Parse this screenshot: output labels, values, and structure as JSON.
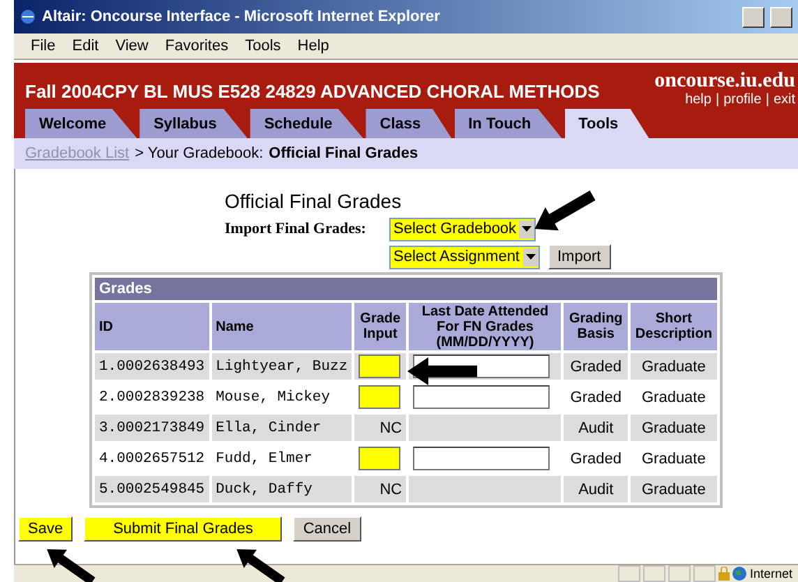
{
  "window": {
    "title": "Altair: Oncourse Interface - Microsoft Internet Explorer"
  },
  "menu": [
    "File",
    "Edit",
    "View",
    "Favorites",
    "Tools",
    "Help"
  ],
  "header": {
    "course": "Fall 2004CPY BL MUS E528 24829 ADVANCED CHORAL METHODS",
    "site": "oncourse.iu.edu",
    "links": [
      "help",
      "profile",
      "exit"
    ],
    "separator": "|"
  },
  "tabs": [
    {
      "label": "Welcome",
      "selected": false
    },
    {
      "label": "Syllabus",
      "selected": false
    },
    {
      "label": "Schedule",
      "selected": false
    },
    {
      "label": "Class",
      "selected": false
    },
    {
      "label": "In Touch",
      "selected": false
    },
    {
      "label": "Tools",
      "selected": true
    }
  ],
  "breadcrumb": {
    "link": "Gradebook List",
    "text": "> Your Gradebook:",
    "current": "Official Final Grades"
  },
  "heading": "Official Final Grades",
  "import": {
    "label": "Import Final Grades:",
    "gradebook": "Select Gradebook",
    "assignment": "Select Assignment",
    "button": "Import"
  },
  "table": {
    "title": "Grades",
    "columns": [
      "ID",
      "Name",
      "Grade Input",
      "Last Date Attended For FN Grades (MM/DD/YYYY)",
      "Grading Basis",
      "Short Description"
    ],
    "rows": [
      {
        "id": "1.0002638493",
        "name": "Lightyear, Buzz",
        "grade": {
          "kind": "input"
        },
        "basis": "Graded",
        "description": "Graduate"
      },
      {
        "id": "2.0002839238",
        "name": "Mouse, Mickey",
        "grade": {
          "kind": "input"
        },
        "basis": "Graded",
        "description": "Graduate"
      },
      {
        "id": "3.0002173849",
        "name": "Ella, Cinder",
        "grade": {
          "kind": "text",
          "text": "NC"
        },
        "basis": "Audit",
        "description": "Graduate"
      },
      {
        "id": "4.0002657512",
        "name": "Fudd, Elmer",
        "grade": {
          "kind": "input"
        },
        "basis": "Graded",
        "description": "Graduate"
      },
      {
        "id": "5.0002549845",
        "name": "Duck, Daffy",
        "grade": {
          "kind": "text",
          "text": "NC"
        },
        "basis": "Audit",
        "description": "Graduate"
      }
    ]
  },
  "buttons": [
    "Save",
    "Submit Final Grades",
    "Cancel"
  ],
  "status_bar": {
    "zone": "Internet"
  }
}
